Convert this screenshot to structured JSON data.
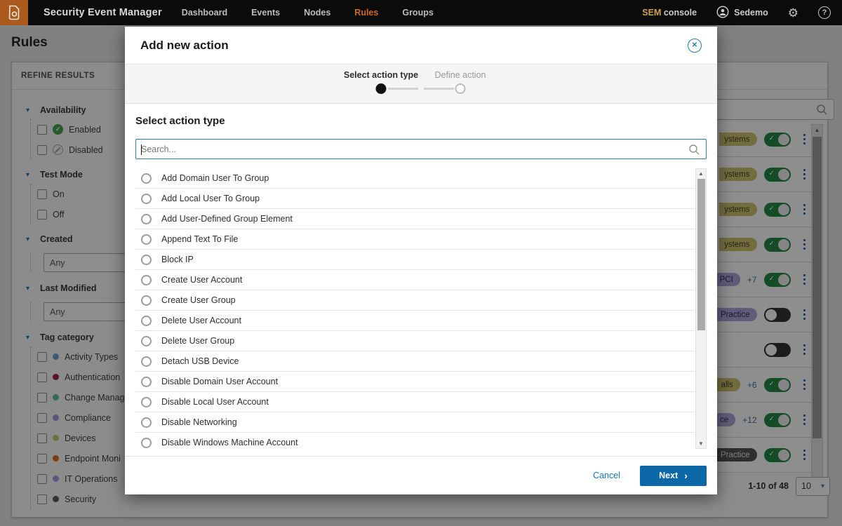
{
  "nav": {
    "app_title": "Security Event Manager",
    "items": [
      {
        "label": "Dashboard",
        "active": false
      },
      {
        "label": "Events",
        "active": false
      },
      {
        "label": "Nodes",
        "active": false
      },
      {
        "label": "Rules",
        "active": true
      },
      {
        "label": "Groups",
        "active": false
      }
    ],
    "console_label_sem": "SEM",
    "console_label_rest": "console",
    "user_name": "Sedemo"
  },
  "page": {
    "title": "Rules",
    "refine": {
      "header": "REFINE RESULTS",
      "sections": [
        {
          "label": "Availability",
          "type": "checks",
          "options": [
            {
              "label": "Enabled",
              "status_icon": "enabled"
            },
            {
              "label": "Disabled",
              "status_icon": "disabled"
            }
          ]
        },
        {
          "label": "Test Mode",
          "type": "checks",
          "options": [
            {
              "label": "On"
            },
            {
              "label": "Off"
            }
          ]
        },
        {
          "label": "Created",
          "type": "select",
          "value": "Any"
        },
        {
          "label": "Last Modified",
          "type": "select",
          "value": "Any"
        },
        {
          "label": "Tag category",
          "type": "checks",
          "options": [
            {
              "label": "Activity Types",
              "dot": "#64a0c8"
            },
            {
              "label": "Authentication",
              "dot": "#9c1f4e"
            },
            {
              "label": "Change Manag",
              "dot": "#5cb8ac"
            },
            {
              "label": "Compliance",
              "dot": "#a88fd4"
            },
            {
              "label": "Devices",
              "dot": "#c9c96a"
            },
            {
              "label": "Endpoint Moni",
              "dot": "#e06a1a"
            },
            {
              "label": "IT Operations",
              "dot": "#9e97e0"
            },
            {
              "label": "Security",
              "dot": "#555555"
            }
          ]
        }
      ]
    },
    "table": {
      "rows": [
        {
          "tag": "ystems",
          "tag_style": "olive",
          "extra": "",
          "toggle": "on"
        },
        {
          "tag": "ystems",
          "tag_style": "olive",
          "extra": "",
          "toggle": "on"
        },
        {
          "tag": "ystems",
          "tag_style": "olive",
          "extra": "",
          "toggle": "on"
        },
        {
          "tag": "ystems",
          "tag_style": "olive",
          "extra": "",
          "toggle": "on"
        },
        {
          "tag": "PCI",
          "tag_style": "purple",
          "extra": "+7",
          "toggle": "on"
        },
        {
          "tag": "Practice",
          "tag_style": "purple",
          "extra": "",
          "toggle": "off"
        },
        {
          "tag": "",
          "tag_style": "",
          "extra": "",
          "toggle": "off"
        },
        {
          "tag": "alls",
          "tag_style": "olive",
          "extra": "+6",
          "toggle": "on"
        },
        {
          "tag": "ce",
          "tag_style": "purple",
          "extra": "+12",
          "toggle": "on"
        },
        {
          "tag": "Practice",
          "tag_style": "dark",
          "extra": "",
          "toggle": "on"
        }
      ],
      "pagination": {
        "range": "1-10 of 48",
        "page_size": "10"
      }
    }
  },
  "modal": {
    "title": "Add new action",
    "steps": [
      {
        "label": "Select action type",
        "state": "active"
      },
      {
        "label": "Define action",
        "state": "next"
      }
    ],
    "section_title": "Select action type",
    "search_placeholder": "Search...",
    "actions": [
      "Add Domain User To Group",
      "Add Local User To Group",
      "Add User-Defined Group Element",
      "Append Text To File",
      "Block IP",
      "Create User Account",
      "Create User Group",
      "Delete User Account",
      "Delete User Group",
      "Detach USB Device",
      "Disable Domain User Account",
      "Disable Local User Account",
      "Disable Networking",
      "Disable Windows Machine Account"
    ],
    "footer": {
      "cancel": "Cancel",
      "next": "Next"
    }
  },
  "colors": {
    "nav_accent_orange": "#cf6a1f",
    "toggle_on_green": "#1f8540",
    "toggle_off_dark": "#2d2d2d",
    "pill_olive_bg": "#cdc36c",
    "pill_olive_fg": "#3d3a1e",
    "pill_purple_bg": "#b0a3d8",
    "pill_purple_fg": "#2c2552",
    "pill_dark_bg": "#4e4e4e",
    "pill_dark_fg": "#ececec",
    "primary_button_blue": "#0d68a7",
    "link_blue": "#1576b4",
    "close_icon_teal": "#1f80a5"
  }
}
